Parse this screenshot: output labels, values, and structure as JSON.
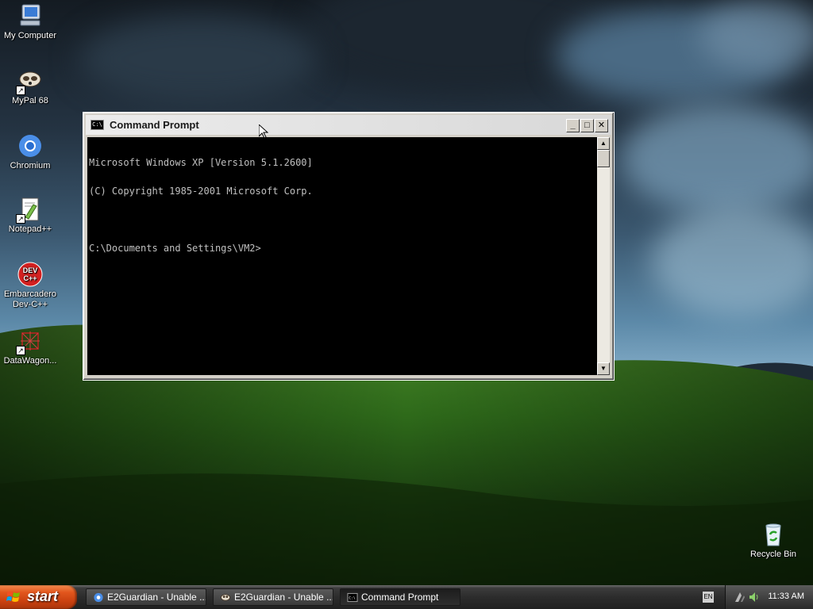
{
  "desktop": {
    "icons": [
      {
        "label": "My Computer",
        "icon": "my-computer-icon"
      },
      {
        "label": "MyPal 68",
        "icon": "mypal-icon"
      },
      {
        "label": "Chromium",
        "icon": "chromium-icon"
      },
      {
        "label": "Notepad++",
        "icon": "notepadpp-icon"
      },
      {
        "label": "Embarcadero Dev-C++",
        "icon": "devcpp-icon",
        "icon_text": "DEV\nC++"
      },
      {
        "label": "DataWagon...",
        "icon": "datawagon-icon"
      },
      {
        "label": "Recycle Bin",
        "icon": "recycle-bin-icon"
      }
    ]
  },
  "window": {
    "title": "Command Prompt",
    "icon_text": "C:\\",
    "buttons": {
      "minimize": "_",
      "maximize": "□",
      "close": "✕"
    },
    "console_lines": [
      "Microsoft Windows XP [Version 5.1.2600]",
      "(C) Copyright 1985-2001 Microsoft Corp.",
      "",
      "C:\\Documents and Settings\\VM2>"
    ],
    "scroll_up": "▲",
    "scroll_down": "▼"
  },
  "taskbar": {
    "start_label": "start",
    "tasks": [
      {
        "label": "E2Guardian - Unable ...",
        "icon": "chromium-icon"
      },
      {
        "label": "E2Guardian - Unable ...",
        "icon": "mypal-icon"
      },
      {
        "label": "Command Prompt",
        "icon": "cmd-icon",
        "active": true
      }
    ],
    "language": "EN",
    "clock": "11:33 AM"
  },
  "colors": {
    "console_bg": "#000000",
    "console_fg": "#c0c0c0",
    "start_orange": "#d84a14"
  }
}
